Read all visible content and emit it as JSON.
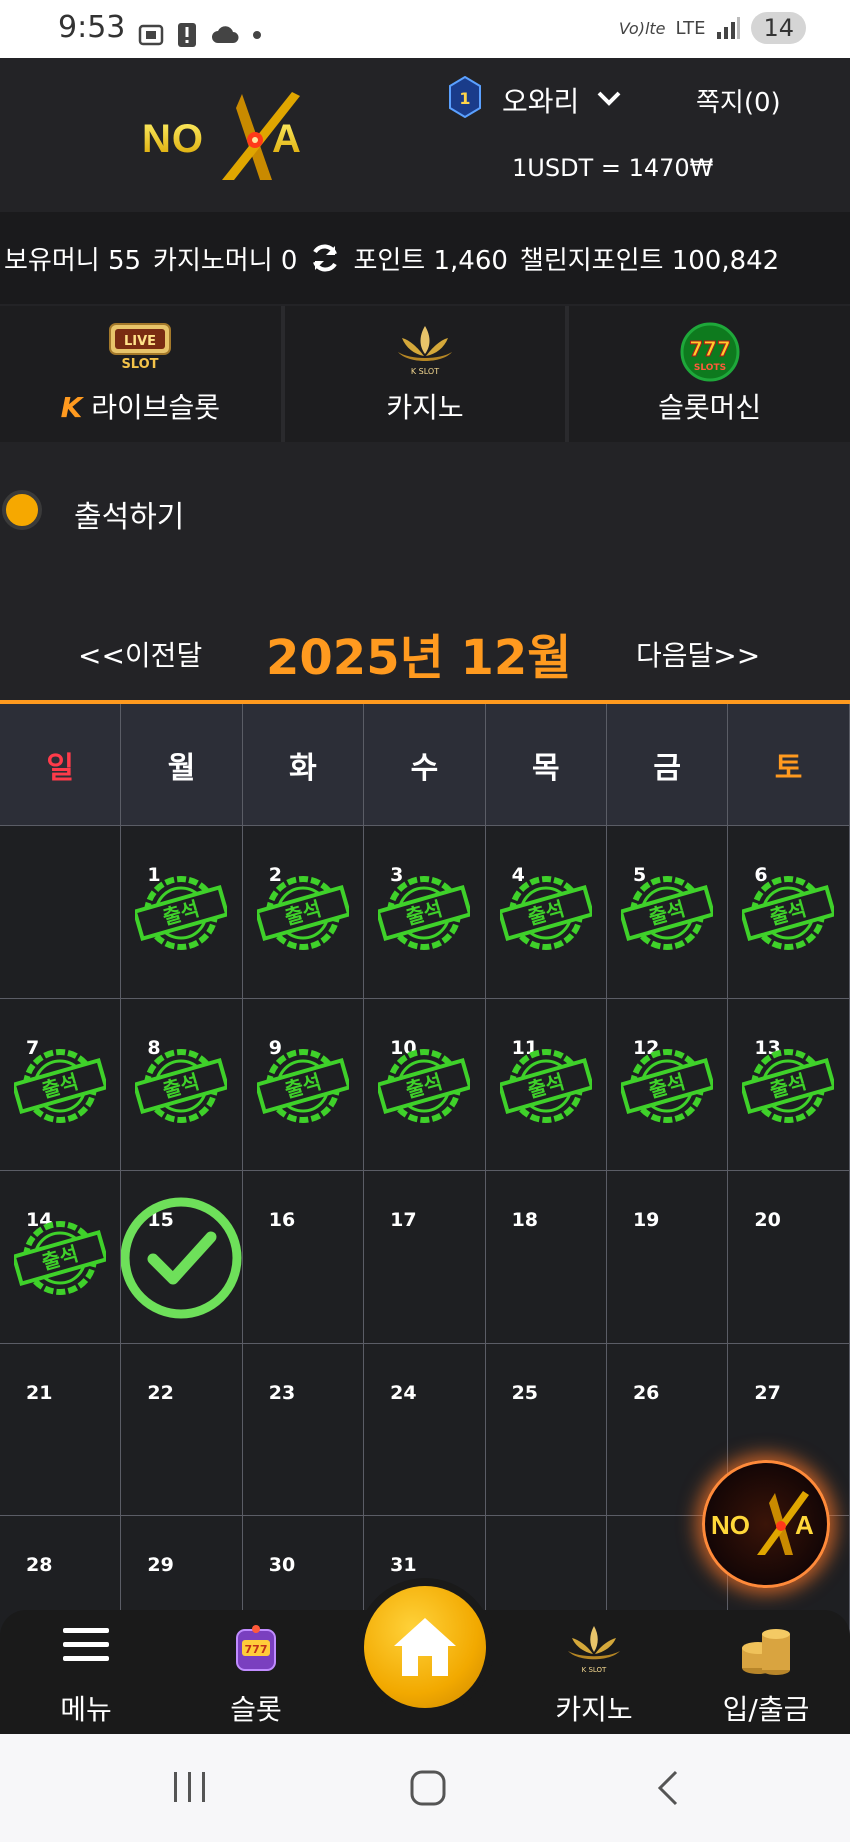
{
  "status_bar": {
    "time": "9:53",
    "network": "LTE",
    "volte": "Vo)lte",
    "battery": "14"
  },
  "header": {
    "logo_text": "NOVA",
    "level": "1",
    "username": "오와리",
    "messages": "쪽지(0)",
    "rate": "1USDT = 1470₩"
  },
  "balances": {
    "money": "보유머니 55",
    "casino_money": "카지노머니 0",
    "points": "포인트 1,460",
    "challenge_points": "챌린지포인트 100,842"
  },
  "categories": [
    {
      "label": "라이브슬롯",
      "prefix": "K"
    },
    {
      "label": "카지노"
    },
    {
      "label": "슬롯머신"
    }
  ],
  "attendance": {
    "title": "출석하기"
  },
  "calendar": {
    "prev": "<<이전달",
    "title": "2025년 12월",
    "next": "다음달>>",
    "weekdays": [
      "일",
      "월",
      "화",
      "수",
      "목",
      "금",
      "토"
    ],
    "stamp_text": "출석",
    "days": [
      "",
      "1",
      "2",
      "3",
      "4",
      "5",
      "6",
      "7",
      "8",
      "9",
      "10",
      "11",
      "12",
      "13",
      "14",
      "15",
      "16",
      "17",
      "18",
      "19",
      "20",
      "21",
      "22",
      "23",
      "24",
      "25",
      "26",
      "27",
      "28",
      "29",
      "30",
      "31",
      "",
      "",
      ""
    ],
    "attended_days": [
      "1",
      "2",
      "3",
      "4",
      "5",
      "6",
      "7",
      "8",
      "9",
      "10",
      "11",
      "12",
      "13",
      "14"
    ],
    "today": "15"
  },
  "bottom_nav": {
    "menu": "메뉴",
    "slot": "슬롯",
    "casino": "카지노",
    "deposit": "입/출금"
  },
  "colors": {
    "accent": "#ff9a1f",
    "stamp": "#3fd12a",
    "check": "#6ee05a",
    "sunday": "#ff3b4a"
  }
}
